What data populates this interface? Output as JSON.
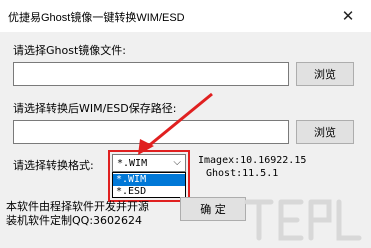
{
  "window": {
    "title": "优捷易Ghost镜像一键转换WIM/ESD",
    "close_glyph": "✕"
  },
  "ghost_file": {
    "label": "请选择Ghost镜像文件:",
    "value": "",
    "browse_label": "浏览"
  },
  "save_path": {
    "label": "请选择转换后WIM/ESD保存路径:",
    "value": "",
    "browse_label": "浏览"
  },
  "format": {
    "label": "请选择转换格式:",
    "selected": "*.WIM",
    "options": [
      "*.WIM",
      "*.ESD"
    ]
  },
  "info": {
    "imagex": "Imagex:10.16922.15",
    "ghost": "Ghost:11.5.1"
  },
  "footer": {
    "line1": "本软件由程择软件开发并开源",
    "line2": "装机软件定制QQ:3602624",
    "confirm_label": "确  定"
  },
  "colors": {
    "annotation_red": "#e02020",
    "selection_blue": "#0078d7"
  }
}
